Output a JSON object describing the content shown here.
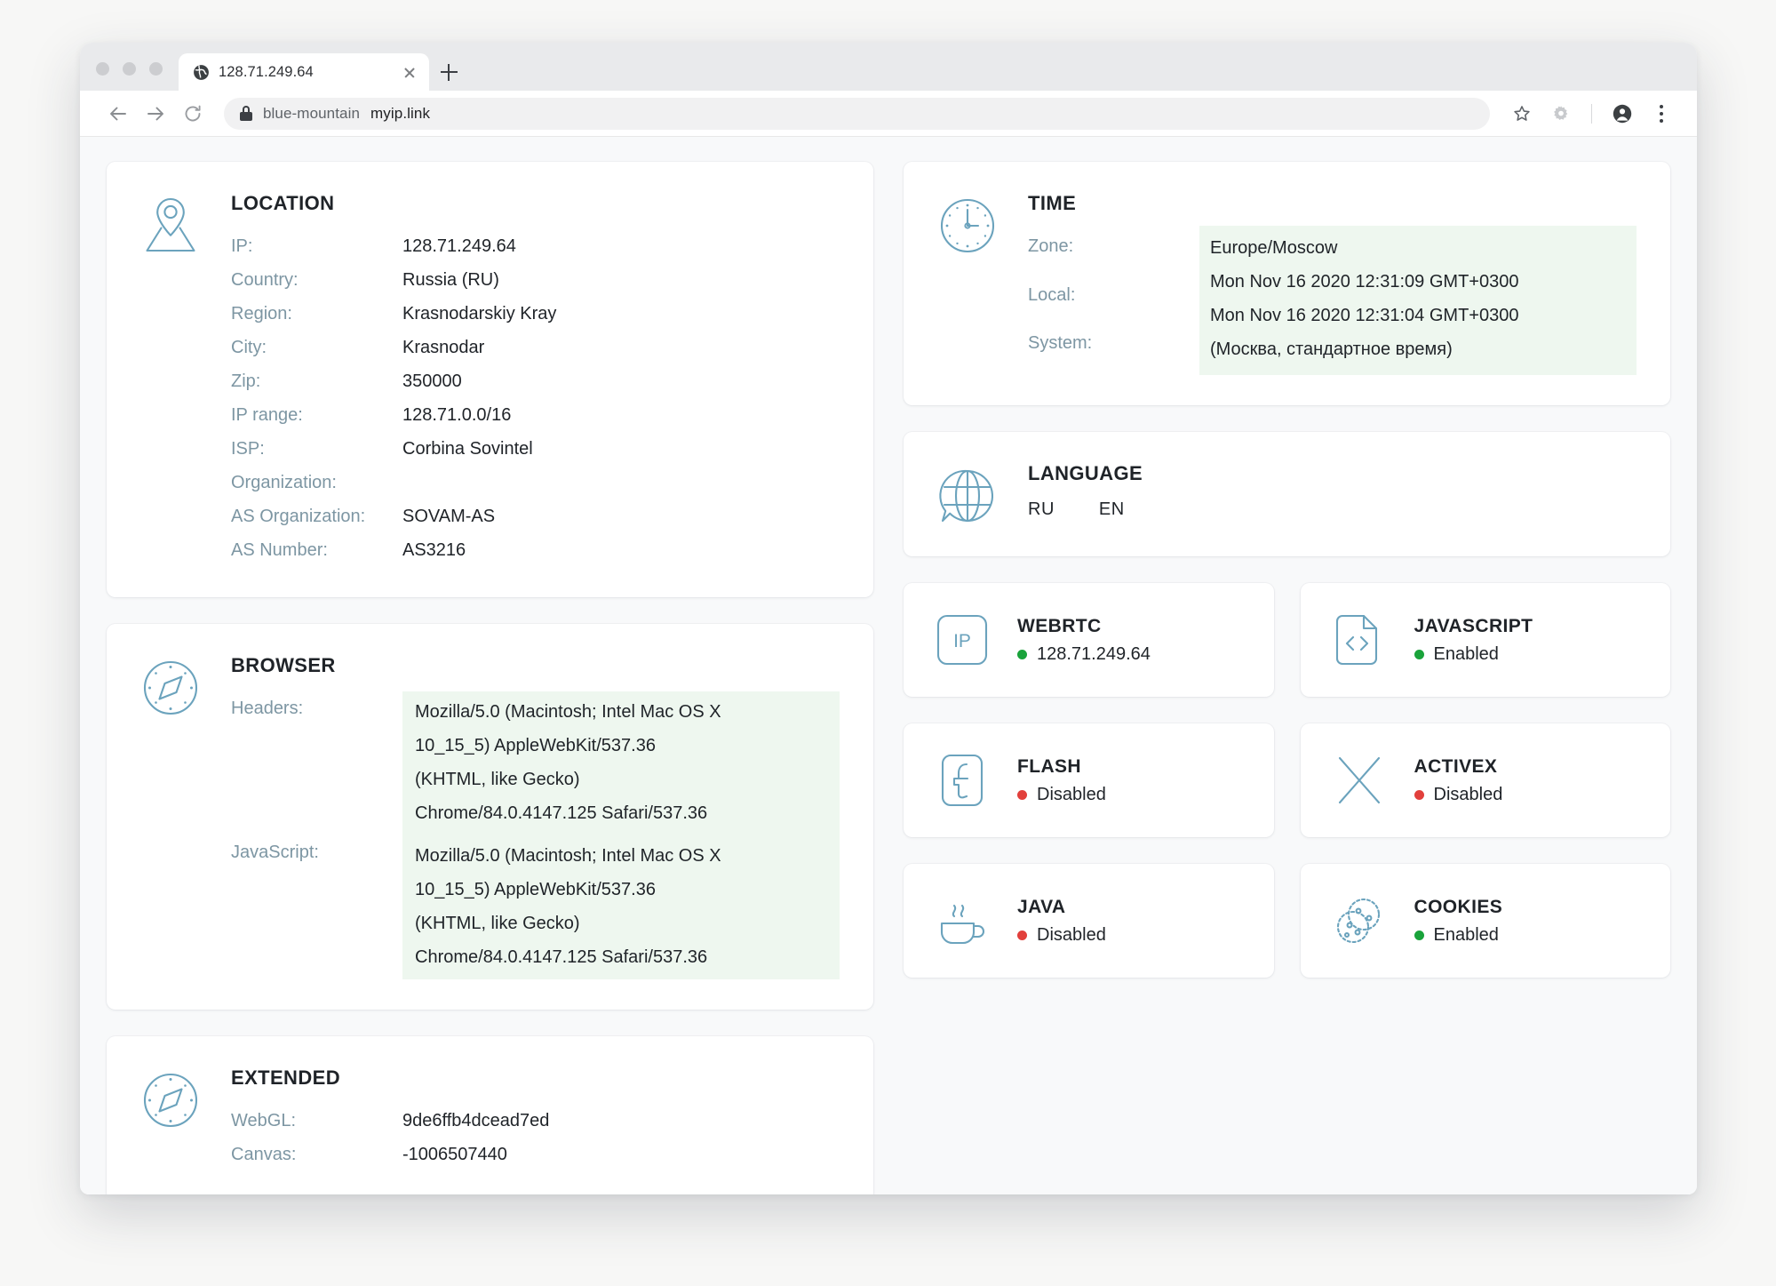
{
  "browser_chrome": {
    "tab": {
      "title": "128.71.249.64",
      "favicon": "globe-icon",
      "close": "close-icon"
    },
    "new_tab": "+",
    "omnibox": {
      "lock": "lock-icon",
      "prefix": "blue-mountain",
      "host": "myip.link"
    },
    "toolbar_icons": [
      "back-icon",
      "forward-icon",
      "reload-icon",
      "bookmark-star-icon",
      "gear-icon",
      "profile-avatar-icon",
      "kebab-menu-icon"
    ]
  },
  "location": {
    "title": "LOCATION",
    "icon": "map-pin-icon",
    "rows": [
      {
        "label": "IP:",
        "value": "128.71.249.64"
      },
      {
        "label": "Country:",
        "value": "Russia (RU)"
      },
      {
        "label": "Region:",
        "value": "Krasnodarskiy Kray"
      },
      {
        "label": "City:",
        "value": "Krasnodar"
      },
      {
        "label": "Zip:",
        "value": "350000"
      },
      {
        "label": "IP range:",
        "value": "128.71.0.0/16"
      },
      {
        "label": "ISP:",
        "value": "Corbina Sovintel"
      },
      {
        "label": "Organization:",
        "value": ""
      },
      {
        "label": "AS Organization:",
        "value": "SOVAM-AS"
      },
      {
        "label": "AS Number:",
        "value": "AS3216"
      }
    ]
  },
  "time": {
    "title": "TIME",
    "icon": "clock-icon",
    "labels": [
      "Zone:",
      "Local:",
      "System:"
    ],
    "values": [
      "Europe/Moscow",
      "Mon Nov 16 2020 12:31:09 GMT+0300",
      "Mon Nov 16 2020 12:31:04 GMT+0300",
      "(Москва, стандартное время)"
    ],
    "highlight_color": "#eef7ef"
  },
  "language": {
    "title": "LANGUAGE",
    "icon": "globe-speech-icon",
    "codes": [
      "RU",
      "EN"
    ]
  },
  "browser_card": {
    "title": "BROWSER",
    "icon": "compass-icon",
    "labels": [
      "Headers:",
      "JavaScript:"
    ],
    "headers_lines": [
      "Mozilla/5.0 (Macintosh; Intel Mac OS X",
      "10_15_5) AppleWebKit/537.36",
      "(KHTML, like Gecko)",
      "Chrome/84.0.4147.125 Safari/537.36"
    ],
    "javascript_lines": [
      "Mozilla/5.0 (Macintosh; Intel Mac OS X",
      "10_15_5) AppleWebKit/537.36",
      "(KHTML, like Gecko)",
      "Chrome/84.0.4147.125 Safari/537.36"
    ]
  },
  "extended": {
    "title": "EXTENDED",
    "icon": "compass-icon",
    "rows": [
      {
        "label": "WebGL:",
        "value": "9de6ffb4dcead7ed"
      },
      {
        "label": "Canvas:",
        "value": "-1006507440"
      }
    ]
  },
  "features": [
    {
      "title": "WEBRTC",
      "icon": "ip-box-icon",
      "status": "128.71.249.64",
      "state": "ok",
      "color": "#1aa33b"
    },
    {
      "title": "JAVASCRIPT",
      "icon": "code-document-icon",
      "status": "Enabled",
      "state": "ok",
      "color": "#1aa33b"
    },
    {
      "title": "FLASH",
      "icon": "flash-icon",
      "status": "Disabled",
      "state": "bad",
      "color": "#e2403c"
    },
    {
      "title": "ACTIVEX",
      "icon": "x-cross-icon",
      "status": "Disabled",
      "state": "bad",
      "color": "#e2403c"
    },
    {
      "title": "JAVA",
      "icon": "coffee-cup-icon",
      "status": "Disabled",
      "state": "bad",
      "color": "#e2403c"
    },
    {
      "title": "COOKIES",
      "icon": "cookies-icon",
      "status": "Enabled",
      "state": "ok",
      "color": "#1aa33b"
    }
  ],
  "theme": {
    "accent": "#6ba3bd",
    "label": "#7d96a3",
    "text": "#1f2328",
    "highlight": "#eef7ef"
  }
}
